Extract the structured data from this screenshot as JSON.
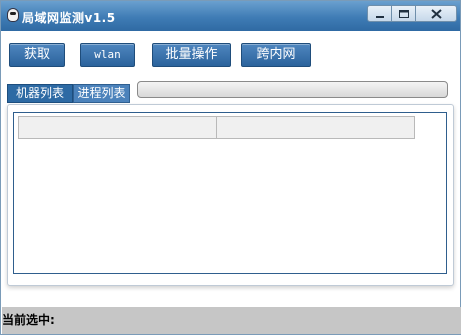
{
  "window": {
    "title": "局域网监测v1.5",
    "icon": "penguin-icon"
  },
  "toolbar": {
    "fetch_label": "获取",
    "wlan_label": "wlan",
    "batch_label": "批量操作",
    "cross_label": "跨内网"
  },
  "tabs": [
    {
      "label": "机器列表",
      "active": true
    },
    {
      "label": "进程列表",
      "active": false
    }
  ],
  "list": {
    "columns": [
      "",
      ""
    ]
  },
  "status": {
    "label": "当前选中:"
  },
  "colors": {
    "titlebar": "#3f7cb5",
    "button": "#2b639c",
    "tab_active": "#2d6aa4",
    "statusbar": "#c6c6c6"
  }
}
